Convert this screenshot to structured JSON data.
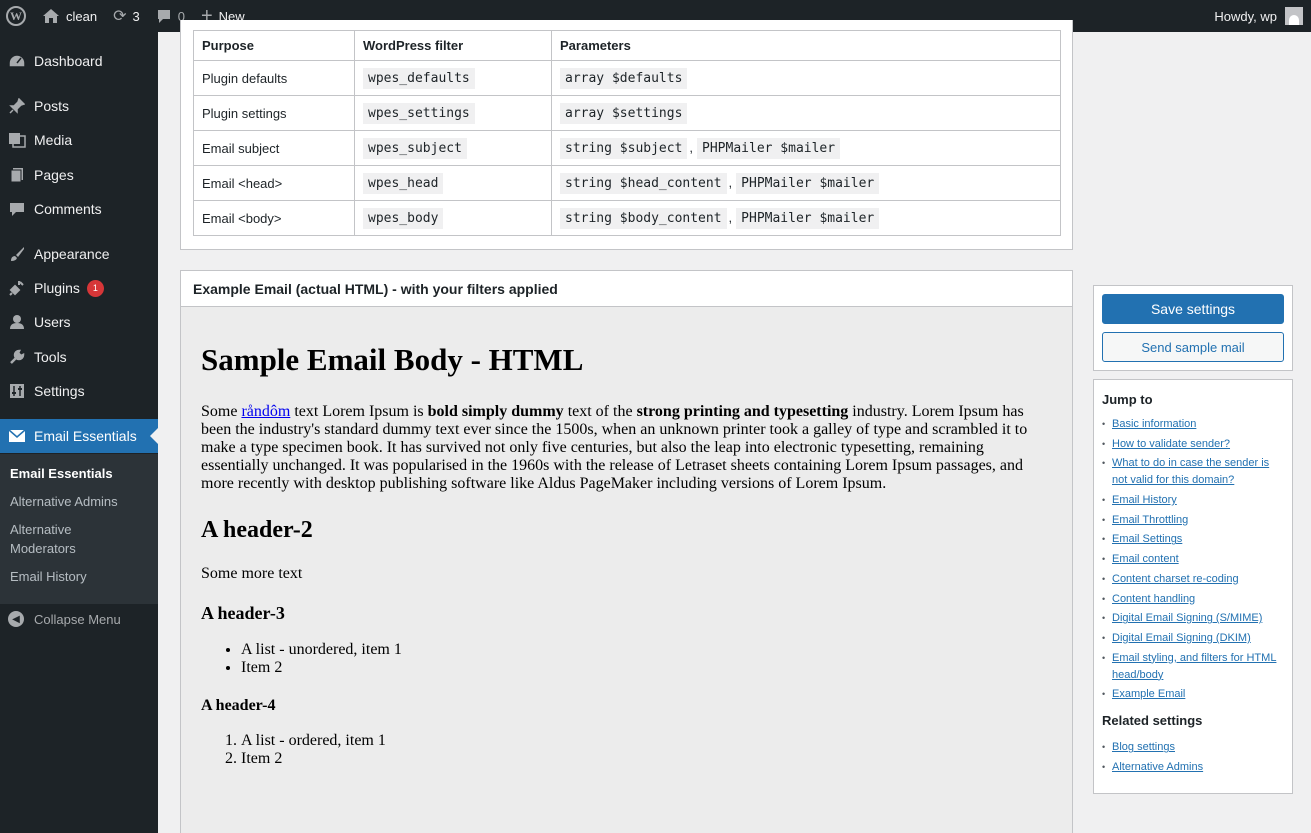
{
  "adminbar": {
    "site_name": "clean",
    "updates_count": "3",
    "comments_count": "0",
    "new_label": "New",
    "greeting": "Howdy, wp"
  },
  "sidebar": {
    "items": [
      {
        "label": "Dashboard",
        "icon": "dashboard-icon"
      },
      {
        "label": "Posts",
        "icon": "pin-icon"
      },
      {
        "label": "Media",
        "icon": "media-icon"
      },
      {
        "label": "Pages",
        "icon": "pages-icon"
      },
      {
        "label": "Comments",
        "icon": "comment-icon"
      },
      {
        "label": "Appearance",
        "icon": "brush-icon"
      },
      {
        "label": "Plugins",
        "icon": "plugin-icon",
        "badge": "1"
      },
      {
        "label": "Users",
        "icon": "user-icon"
      },
      {
        "label": "Tools",
        "icon": "wrench-icon"
      },
      {
        "label": "Settings",
        "icon": "settings-icon"
      },
      {
        "label": "Email Essentials",
        "icon": "email-icon"
      }
    ],
    "submenu": [
      "Email Essentials",
      "Alternative Admins",
      "Alternative Moderators",
      "Email History"
    ],
    "collapse_label": "Collapse Menu"
  },
  "filters_table": {
    "headers": [
      "Purpose",
      "WordPress filter",
      "Parameters"
    ],
    "rows": [
      {
        "purpose": "Plugin defaults",
        "filter": "wpes_defaults",
        "p1": "array $defaults",
        "p2": ""
      },
      {
        "purpose": "Plugin settings",
        "filter": "wpes_settings",
        "p1": "array $settings",
        "p2": ""
      },
      {
        "purpose": "Email subject",
        "filter": "wpes_subject",
        "p1": "string $subject",
        "p2": "PHPMailer $mailer"
      },
      {
        "purpose": "Email <head>",
        "filter": "wpes_head",
        "p1": "string $head_content",
        "p2": "PHPMailer $mailer"
      },
      {
        "purpose": "Email <body>",
        "filter": "wpes_body",
        "p1": "string $body_content",
        "p2": "PHPMailer $mailer"
      }
    ],
    "separator": ","
  },
  "example": {
    "panel_title": "Example Email (actual HTML) - with your filters applied",
    "h1": "Sample Email Body - HTML",
    "p_some": "Some ",
    "p_link": "råndôm",
    "p_mid1": " text Lorem Ipsum is ",
    "p_bold1": "bold simply dummy",
    "p_mid2": " text of the ",
    "p_bold2": "strong printing and typesetting",
    "p_rest": " industry. Lorem Ipsum has been the industry's standard dummy text ever since the 1500s, when an unknown printer took a galley of type and scrambled it to make a type specimen book. It has survived not only five centuries, but also the leap into electronic typesetting, remaining essentially unchanged. It was popularised in the 1960s with the release of Letraset sheets containing Lorem Ipsum passages, and more recently with desktop publishing software like Aldus PageMaker including versions of Lorem Ipsum.",
    "h2": "A header-2",
    "more_text": "Some more text",
    "h3": "A header-3",
    "ul": [
      "A list - unordered, item 1",
      "Item 2"
    ],
    "h4": "A header-4",
    "ol": [
      "A list - ordered, item 1",
      "Item 2"
    ]
  },
  "actions": {
    "save_label": "Save settings",
    "send_label": "Send sample mail"
  },
  "jump": {
    "title": "Jump to",
    "links": [
      "Basic information",
      "How to validate sender?",
      "What to do in case the sender is not valid for this domain?",
      "Email History",
      "Email Throttling",
      "Email Settings",
      "Email content",
      "Content charset re-coding",
      "Content handling",
      "Digital Email Signing (S/MIME)",
      "Digital Email Signing (DKIM)",
      "Email styling, and filters for HTML head/body",
      "Example Email"
    ],
    "related_title": "Related settings",
    "related": [
      "Blog settings",
      "Alternative Admins"
    ]
  },
  "colors": {
    "admin_dark": "#1d2327",
    "accent": "#2271b1",
    "badge": "#d63638"
  }
}
